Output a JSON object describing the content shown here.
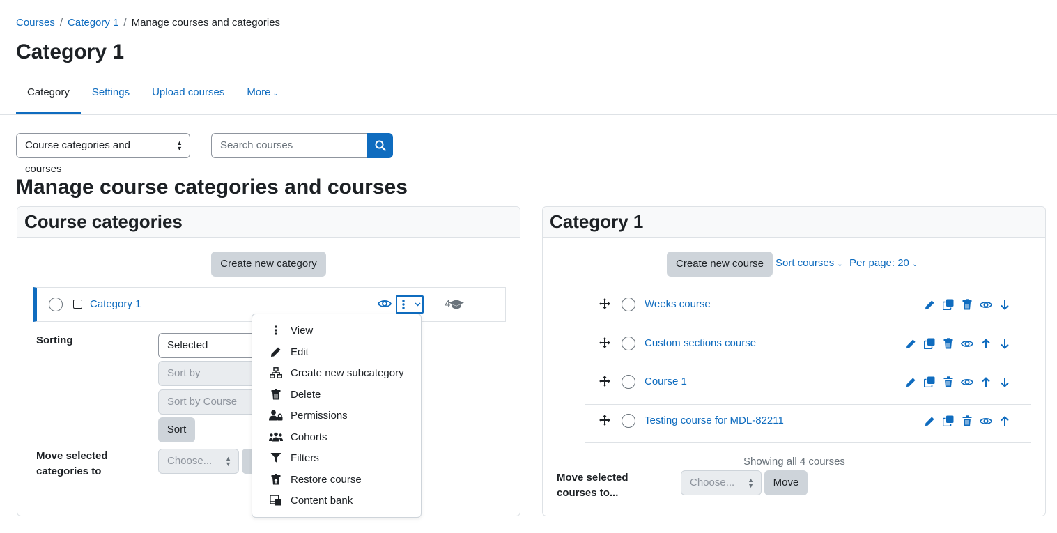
{
  "breadcrumb": {
    "items": [
      "Courses",
      "Category 1"
    ],
    "current": "Manage courses and categories",
    "separator": "/"
  },
  "page_title": "Category 1",
  "tabs": [
    {
      "label": "Category",
      "active": true
    },
    {
      "label": "Settings",
      "active": false
    },
    {
      "label": "Upload courses",
      "active": false
    },
    {
      "label": "More",
      "active": false
    }
  ],
  "view_select": {
    "value": "Course categories and courses"
  },
  "search": {
    "placeholder": "Search courses",
    "icon": "search-icon"
  },
  "section_title": "Manage course categories and courses",
  "categories_panel": {
    "title": "Course categories",
    "create_button": "Create new category",
    "category": {
      "name": "Category 1",
      "course_count": "4"
    },
    "sorting_label": "Sorting",
    "sort_selects": [
      "Selected categorie",
      "Sort by Category n",
      "Sort by Course full"
    ],
    "sort_button": "Sort",
    "move_label_line1": "Move selected",
    "move_label_line2": "categories to",
    "move_select": "Choose..."
  },
  "menu": {
    "items": [
      {
        "label": "View",
        "icon": "dots-vertical-icon"
      },
      {
        "label": "Edit",
        "icon": "pencil-icon"
      },
      {
        "label": "Create new subcategory",
        "icon": "sitemap-icon"
      },
      {
        "label": "Delete",
        "icon": "trash-icon"
      },
      {
        "label": "Permissions",
        "icon": "user-lock-icon"
      },
      {
        "label": "Cohorts",
        "icon": "users-icon"
      },
      {
        "label": "Filters",
        "icon": "filter-icon"
      },
      {
        "label": "Restore course",
        "icon": "trash-restore-icon"
      },
      {
        "label": "Content bank",
        "icon": "content-bank-icon"
      }
    ]
  },
  "courses_panel": {
    "title": "Category 1",
    "create_button": "Create new course",
    "sort_link": "Sort courses",
    "per_page_link": "Per page: 20",
    "courses": [
      {
        "name": "Weeks course",
        "up": false,
        "down": true
      },
      {
        "name": "Custom sections course",
        "up": true,
        "down": true
      },
      {
        "name": "Course 1",
        "up": true,
        "down": true
      },
      {
        "name": "Testing course for MDL-82211",
        "up": true,
        "down": false
      }
    ],
    "showing_text": "Showing all 4 courses",
    "move_label_line1": "Move selected",
    "move_label_line2": "courses to...",
    "move_select": "Choose...",
    "move_button": "Move"
  },
  "colors": {
    "primary": "#0f6cbf",
    "text": "#1d2125",
    "secondary_button": "#ced4da",
    "border": "#dee2e6"
  }
}
